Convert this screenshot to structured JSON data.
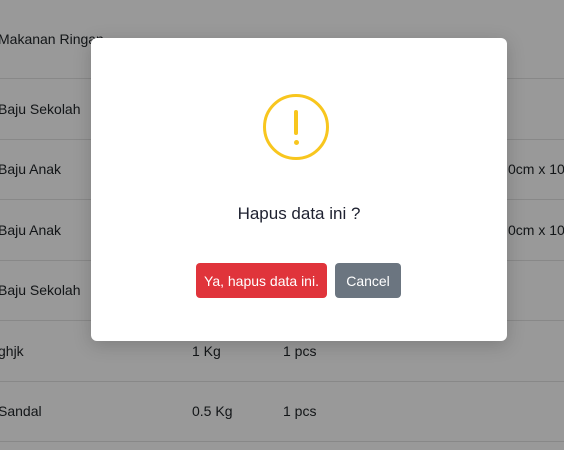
{
  "table": {
    "rows": [
      {
        "name": "Makanan Ringan",
        "weight": "",
        "qty": "",
        "size": ""
      },
      {
        "name": "Baju Sekolah",
        "weight": "",
        "qty": "",
        "size": ""
      },
      {
        "name": "Baju Anak",
        "weight": "",
        "qty": "",
        "size": "0cm x 100"
      },
      {
        "name": "Baju Anak",
        "weight": "",
        "qty": "",
        "size": "0cm x 100"
      },
      {
        "name": "Baju Sekolah",
        "weight": "",
        "qty": "",
        "size": ""
      },
      {
        "name": "ghjk",
        "weight": "1 Kg",
        "qty": "1 pcs",
        "size": ""
      },
      {
        "name": "Sandal",
        "weight": "0.5 Kg",
        "qty": "1 pcs",
        "size": ""
      }
    ]
  },
  "dialog": {
    "icon": "warning-icon",
    "title": "Hapus data ini ?",
    "confirm_label": "Ya, hapus data ini.",
    "cancel_label": "Cancel"
  },
  "colors": {
    "warning": "#f8c61e",
    "confirm": "#e0343b",
    "cancel": "#6b7580"
  }
}
